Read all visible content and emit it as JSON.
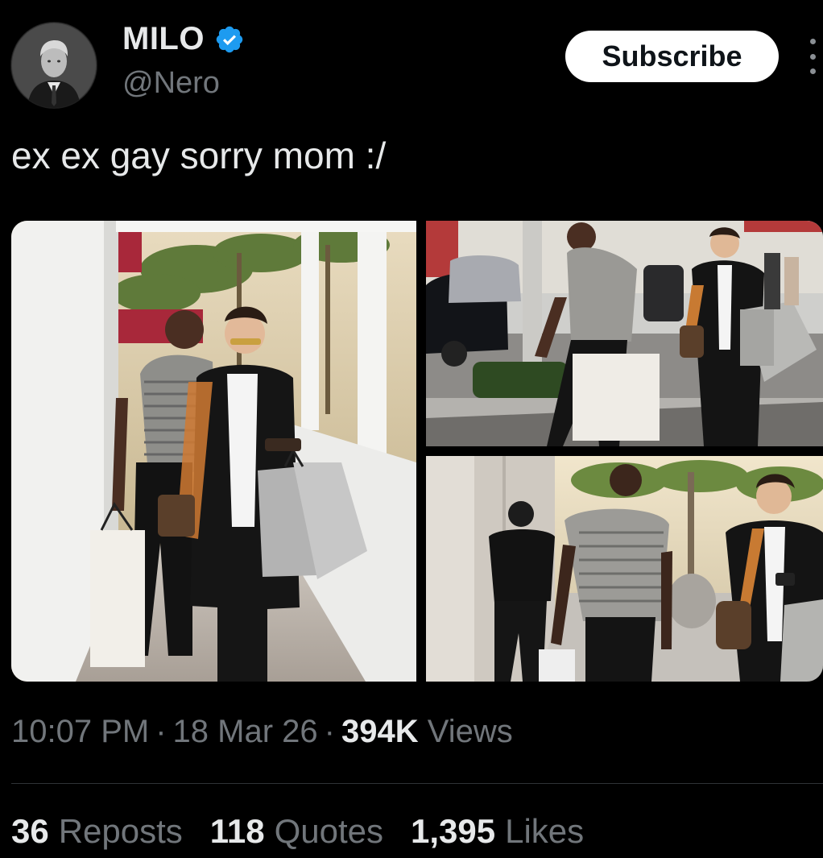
{
  "author": {
    "display_name": "MILO",
    "handle": "@Nero",
    "verified": true,
    "verified_color": "#1d9bf0"
  },
  "actions": {
    "subscribe_label": "Subscribe",
    "more_icon": "more-vertical-icon"
  },
  "tweet": {
    "text": "ex ex gay sorry mom :/"
  },
  "meta": {
    "time": "10:07 PM",
    "date": "18 Mar 26",
    "views_count": "394K",
    "views_label": "Views"
  },
  "stats": {
    "reposts_count": "36",
    "reposts_label": "Reposts",
    "quotes_count": "118",
    "quotes_label": "Quotes",
    "likes_count": "1,395",
    "likes_label": "Likes"
  },
  "media": {
    "count": 3
  }
}
